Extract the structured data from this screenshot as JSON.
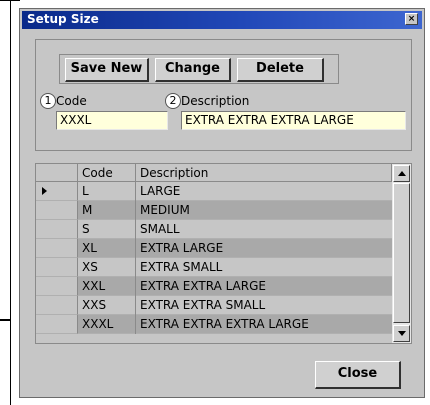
{
  "window": {
    "title": "Setup Size",
    "close_glyph": "×"
  },
  "toolbar": {
    "save_new": "Save New",
    "change": "Change",
    "delete": "Delete"
  },
  "form": {
    "code_number": "1",
    "code_label": "Code",
    "code_value": "XXXL",
    "description_number": "2",
    "description_label": "Description",
    "description_value": "EXTRA EXTRA EXTRA LARGE"
  },
  "grid": {
    "columns": [
      "Code",
      "Description"
    ],
    "rows": [
      {
        "code": "L",
        "description": "LARGE",
        "current": true
      },
      {
        "code": "M",
        "description": "MEDIUM"
      },
      {
        "code": "S",
        "description": "SMALL"
      },
      {
        "code": "XL",
        "description": "EXTRA LARGE"
      },
      {
        "code": "XS",
        "description": "EXTRA SMALL"
      },
      {
        "code": "XXL",
        "description": "EXTRA EXTRA LARGE"
      },
      {
        "code": "XXS",
        "description": "EXTRA EXTRA SMALL"
      },
      {
        "code": "XXXL",
        "description": "EXTRA EXTRA EXTRA LARGE"
      }
    ]
  },
  "footer": {
    "close": "Close"
  },
  "colors": {
    "title_bar": "#0a2a8a",
    "dialog_bg": "#c6c6c6",
    "field_bg": "#ffffdc",
    "row_alt": "#a9a9a9"
  }
}
